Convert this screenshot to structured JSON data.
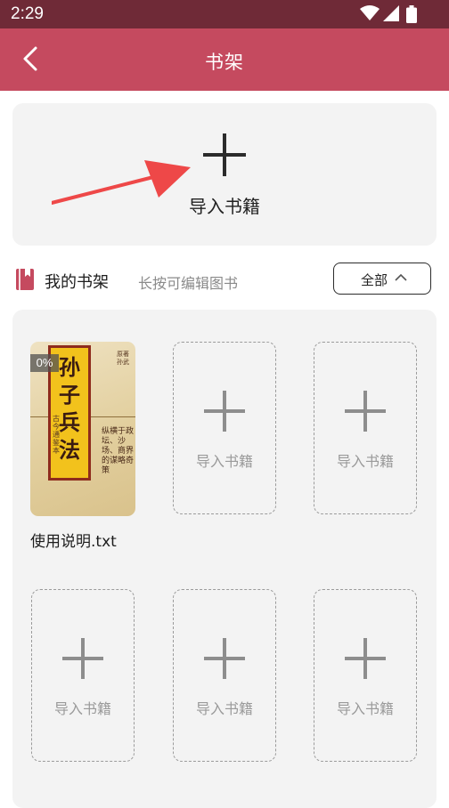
{
  "status_bar": {
    "time": "2:29",
    "icons": [
      "wifi-icon",
      "signal-icon",
      "battery-icon"
    ]
  },
  "app_bar": {
    "title": "书架",
    "back_icon": "back-chevron-icon",
    "color": "#c54a5f"
  },
  "import_card": {
    "label": "导入书籍",
    "icon": "plus-icon"
  },
  "annotation": {
    "arrow_color": "#ee4848"
  },
  "shelf": {
    "title": "我的书架",
    "hint": "长按可编辑图书",
    "filter_label": "全部",
    "icon": "book-icon"
  },
  "books": [
    {
      "name": "使用说明.txt",
      "progress": "0%",
      "cover": {
        "title": "孙子兵法",
        "side_left": "古今通鉴本",
        "side_right": "纵横于政坛、沙场、商界的谋略奇策",
        "author": "原著 孙武"
      }
    }
  ],
  "slots": {
    "label": "导入书籍",
    "count": 5
  }
}
